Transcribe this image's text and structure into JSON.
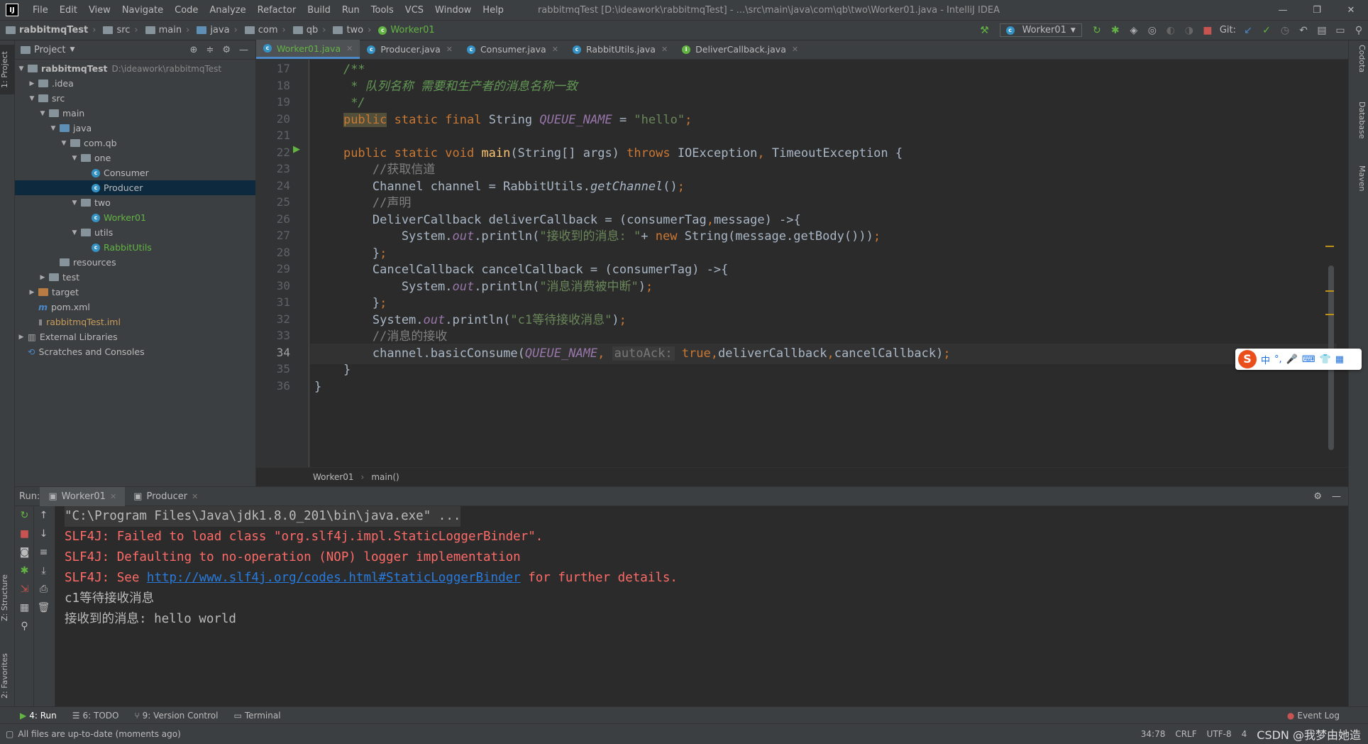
{
  "menubar": {
    "items": [
      "File",
      "Edit",
      "View",
      "Navigate",
      "Code",
      "Analyze",
      "Refactor",
      "Build",
      "Run",
      "Tools",
      "VCS",
      "Window",
      "Help"
    ],
    "title": "rabbitmqTest [D:\\ideawork\\rabbitmqTest] - ...\\src\\main\\java\\com\\qb\\two\\Worker01.java - IntelliJ IDEA"
  },
  "navbar": {
    "crumbs": [
      "rabbitmqTest",
      "src",
      "main",
      "java",
      "com",
      "qb",
      "two",
      "Worker01"
    ],
    "run_config": "Worker01",
    "git_label": "Git:"
  },
  "project": {
    "header": "Project",
    "tree": [
      {
        "label": "rabbitmqTest",
        "extra": "D:\\ideawork\\rabbitmqTest",
        "level": 0,
        "arrow": "▼",
        "kind": "module"
      },
      {
        "label": ".idea",
        "level": 1,
        "arrow": "▶",
        "kind": "folder"
      },
      {
        "label": "src",
        "level": 1,
        "arrow": "▼",
        "kind": "folder"
      },
      {
        "label": "main",
        "level": 2,
        "arrow": "▼",
        "kind": "folder"
      },
      {
        "label": "java",
        "level": 3,
        "arrow": "▼",
        "kind": "folder-blue"
      },
      {
        "label": "com.qb",
        "level": 4,
        "arrow": "▼",
        "kind": "folder"
      },
      {
        "label": "one",
        "level": 5,
        "arrow": "▼",
        "kind": "folder"
      },
      {
        "label": "Consumer",
        "level": 6,
        "arrow": "",
        "kind": "class"
      },
      {
        "label": "Producer",
        "level": 6,
        "arrow": "",
        "kind": "class",
        "selected": true
      },
      {
        "label": "two",
        "level": 5,
        "arrow": "▼",
        "kind": "folder"
      },
      {
        "label": "Worker01",
        "level": 6,
        "arrow": "",
        "kind": "class-green"
      },
      {
        "label": "utils",
        "level": 5,
        "arrow": "▼",
        "kind": "folder"
      },
      {
        "label": "RabbitUtils",
        "level": 6,
        "arrow": "",
        "kind": "class-green"
      },
      {
        "label": "resources",
        "level": 3,
        "arrow": "",
        "kind": "folder"
      },
      {
        "label": "test",
        "level": 2,
        "arrow": "▶",
        "kind": "folder"
      },
      {
        "label": "target",
        "level": 1,
        "arrow": "▶",
        "kind": "folder-orange"
      },
      {
        "label": "pom.xml",
        "level": 1,
        "arrow": "",
        "kind": "maven"
      },
      {
        "label": "rabbitmqTest.iml",
        "level": 1,
        "arrow": "",
        "kind": "iml"
      },
      {
        "label": "External Libraries",
        "level": 0,
        "arrow": "▶",
        "kind": "lib"
      },
      {
        "label": "Scratches and Consoles",
        "level": 0,
        "arrow": "",
        "kind": "scratch"
      }
    ]
  },
  "editor": {
    "tabs": [
      {
        "label": "Worker01.java",
        "active": true
      },
      {
        "label": "Producer.java"
      },
      {
        "label": "Consumer.java"
      },
      {
        "label": "RabbitUtils.java"
      },
      {
        "label": "DeliverCallback.java"
      }
    ],
    "line_numbers": [
      "17",
      "18",
      "19",
      "20",
      "21",
      "22",
      "23",
      "24",
      "25",
      "26",
      "27",
      "28",
      "29",
      "30",
      "31",
      "32",
      "33",
      "34",
      "35",
      "36"
    ],
    "breadcrumb": [
      "Worker01",
      "main()"
    ]
  },
  "run": {
    "label": "Run:",
    "tabs": [
      "Worker01",
      "Producer"
    ],
    "console": [
      {
        "text": "\"C:\\Program Files\\Java\\jdk1.8.0_201\\bin\\java.exe\" ...",
        "kind": "cmd"
      },
      {
        "text": "SLF4J: Failed to load class \"org.slf4j.impl.StaticLoggerBinder\".",
        "kind": "err"
      },
      {
        "text": "SLF4J: Defaulting to no-operation (NOP) logger implementation",
        "kind": "err"
      },
      {
        "prefix": "SLF4J: See ",
        "link": "http://www.slf4j.org/codes.html#StaticLoggerBinder",
        "suffix": " for further details.",
        "kind": "err-link"
      },
      {
        "text": "c1等待接收消息",
        "kind": "out"
      },
      {
        "text": "接收到的消息: hello world",
        "kind": "out"
      }
    ]
  },
  "bottombar": {
    "tabs": [
      "4: Run",
      "6: TODO",
      "9: Version Control",
      "Terminal"
    ],
    "event_log": "Event Log"
  },
  "statusbar": {
    "message": "All files are up-to-date (moments ago)",
    "position": "34:78",
    "line_sep": "CRLF",
    "encoding": "UTF-8",
    "indent": "4",
    "watermark": "CSDN @我梦由她造"
  },
  "side": {
    "left_top": "1: Project",
    "left_structure": "Z: Structure",
    "left_fav": "2: Favorites",
    "right": [
      "Codota",
      "Database",
      "Maven"
    ]
  },
  "ime": {
    "items": [
      "中",
      "°,",
      "🎤",
      "⌨",
      "👕",
      "▦"
    ]
  }
}
